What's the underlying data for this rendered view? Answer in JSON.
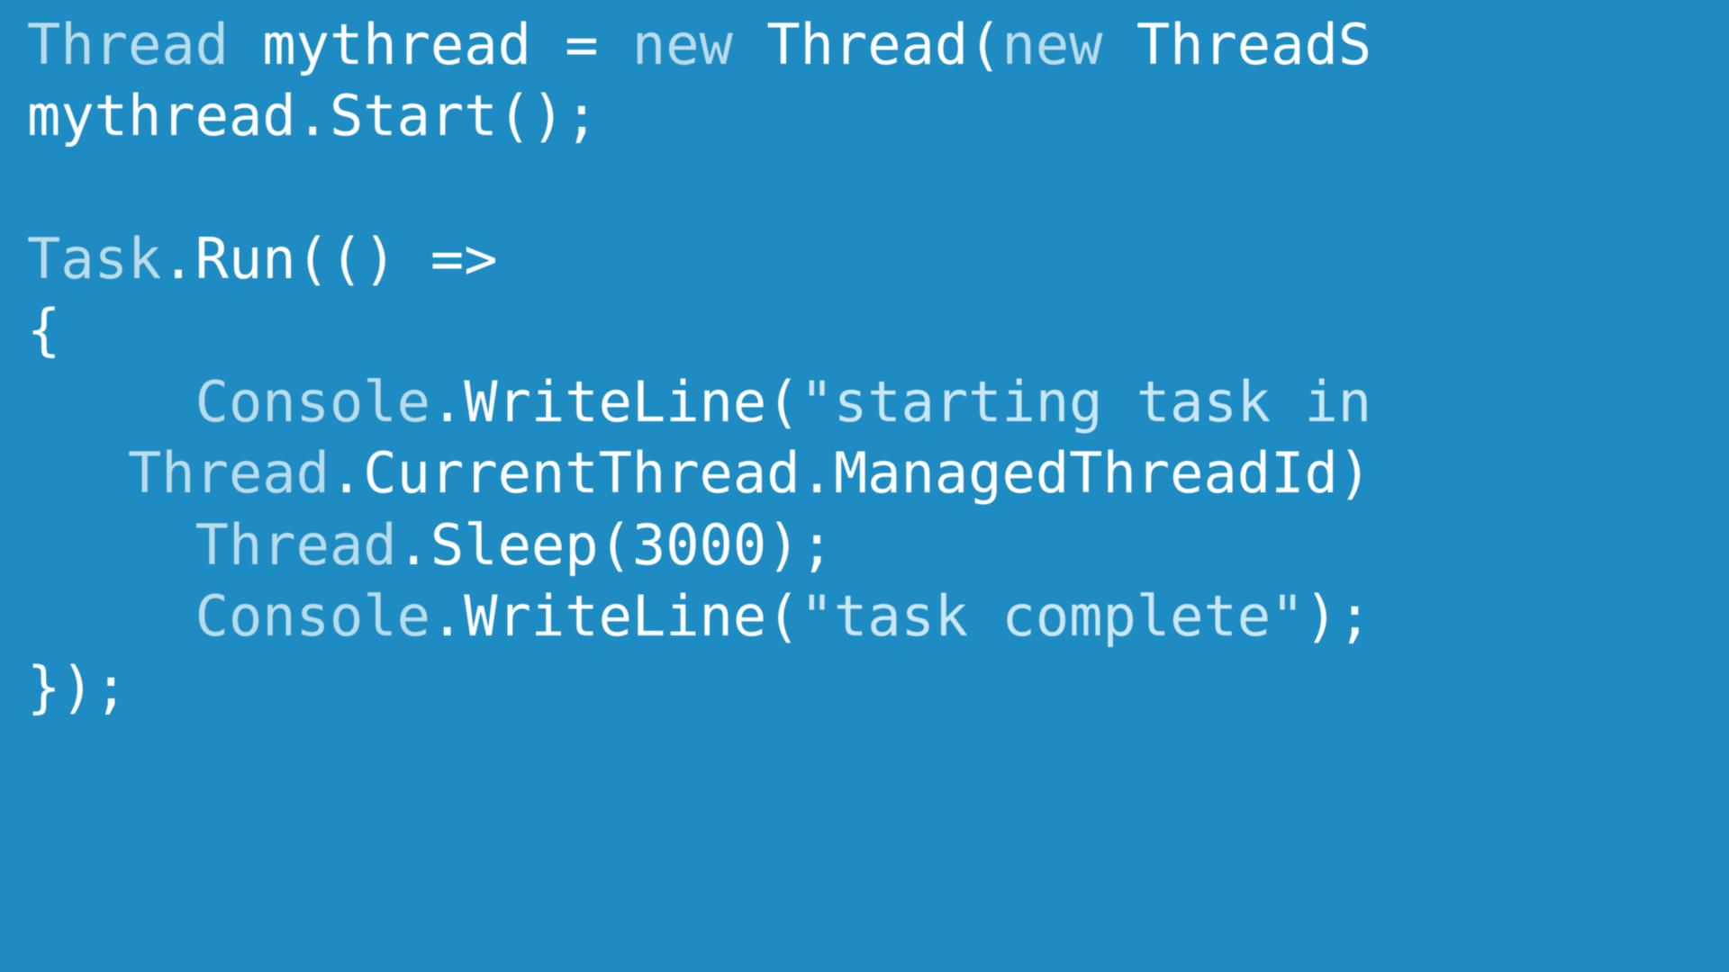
{
  "code": {
    "line1": {
      "t1": "Thread",
      "t2": " mythread ",
      "t3": "=",
      "t4": " ",
      "t5": "new",
      "t6": " Thread(",
      "t7": "new",
      "t8": " ThreadS"
    },
    "line2": {
      "t1": "mythread.Start();"
    },
    "line3": "",
    "line4": {
      "t1": "Task",
      "t2": ".Run(() =>"
    },
    "line5": {
      "t1": "{"
    },
    "line6": {
      "indent": "     ",
      "t1": "Console",
      "t2": ".WriteLine(",
      "t3": "\"starting task in"
    },
    "line7": {
      "indent": "   ",
      "t1": "Thread",
      "t2": ".CurrentThread.ManagedThreadId)"
    },
    "line8": {
      "indent": "     ",
      "t1": "Thread",
      "t2": ".Sleep(",
      "t3": "3000",
      "t4": ");"
    },
    "line9": {
      "indent": "     ",
      "t1": "Console",
      "t2": ".WriteLine(",
      "t3": "\"task complete\"",
      "t4": ");"
    },
    "line10": {
      "t1": "});"
    }
  }
}
